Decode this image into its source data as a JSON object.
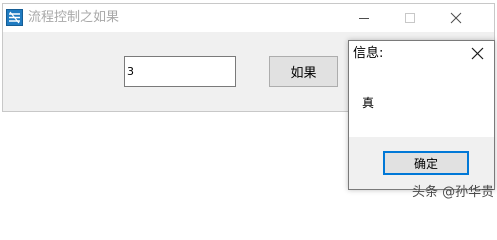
{
  "main_window": {
    "title": "流程控制之如果",
    "input_value": "3",
    "if_button_label": "如果",
    "icons": {
      "app": "app-icon",
      "minimize": "minimize-icon",
      "maximize": "maximize-icon",
      "close": "close-icon"
    }
  },
  "message_dialog": {
    "title": "信息:",
    "message": "真",
    "ok_label": "确定",
    "icons": {
      "close": "close-icon"
    },
    "accent_color": "#0078d7"
  },
  "watermark": {
    "text": "头条 @孙华贵"
  }
}
